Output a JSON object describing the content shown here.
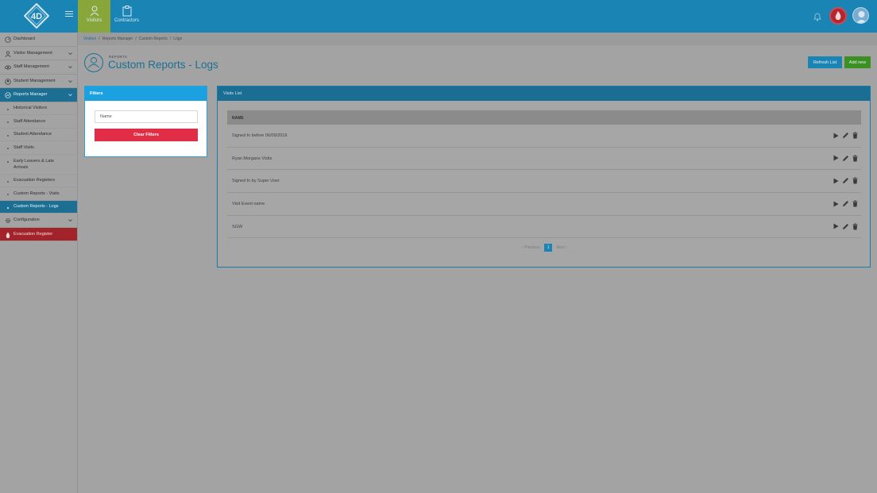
{
  "topbar": {
    "logo_text": "4D",
    "apps": [
      {
        "label": "Visitors",
        "active": true
      },
      {
        "label": "Contractors",
        "active": false
      }
    ]
  },
  "sidebar": {
    "items": [
      {
        "label": "Dashboard"
      },
      {
        "label": "Visitor Management"
      },
      {
        "label": "Staff Management"
      },
      {
        "label": "Student Management"
      },
      {
        "label": "Reports Manager"
      }
    ],
    "sub_items": [
      {
        "label": "Historical Visitors"
      },
      {
        "label": "Staff Attendance"
      },
      {
        "label": "Student Attendance"
      },
      {
        "label": "Staff Visits"
      },
      {
        "label": "Early Leavers & Late Arrivals"
      },
      {
        "label": "Evacuation Registers"
      },
      {
        "label": "Custom Reports - Visits"
      },
      {
        "label": "Custom Reports - Logs"
      }
    ],
    "configuration": "Configuration",
    "evacuation": "Evacuation Register"
  },
  "breadcrumb": [
    "Visitors",
    "Reports Manager",
    "Custom Reports",
    "Logs"
  ],
  "page": {
    "eyebrow": "REPORTS",
    "title": "Custom Reports - Logs",
    "refresh_label": "Refresh List",
    "add_label": "Add new"
  },
  "filters": {
    "title": "Filters",
    "name_placeholder": "Name",
    "clear_label": "Clear Filters"
  },
  "visits": {
    "title": "Visits List",
    "column_name": "NAME",
    "rows": [
      "Signed In before 06/09/2019",
      "Ryan Morgans Visits",
      "Signed In by Super User",
      "Visit Event name",
      "SGW"
    ],
    "pager": {
      "prev": "Previous",
      "current": "1",
      "next": "Next"
    }
  },
  "colors": {
    "primary": "#1a84b5",
    "success": "#3a9122",
    "danger": "#e12e46",
    "filters_header": "#1ca1e0"
  }
}
